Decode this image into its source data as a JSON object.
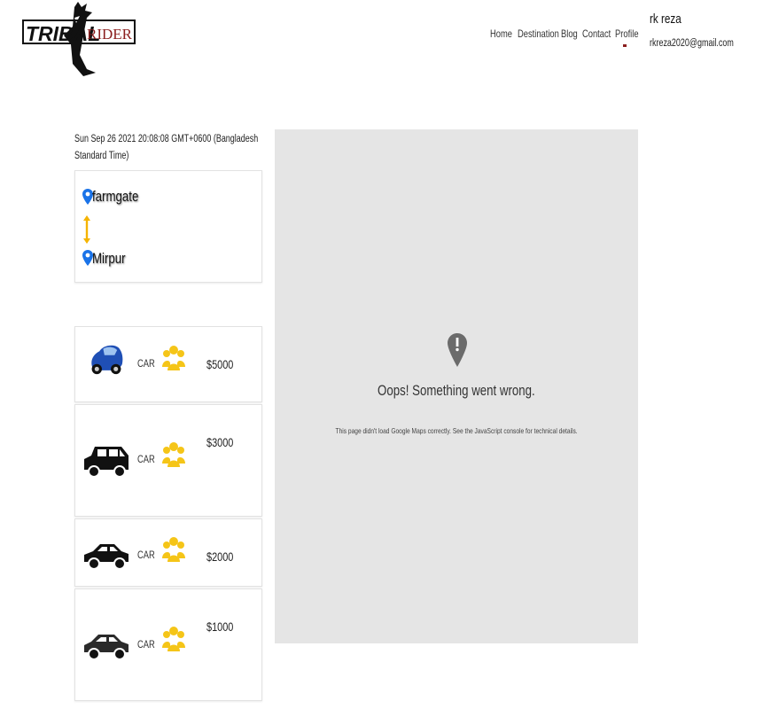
{
  "header": {
    "logo_text_left": "TRIBAL",
    "logo_text_right": "RIDER",
    "nav": [
      "Home",
      "Destination",
      "Blog",
      "Contact",
      "Profile"
    ],
    "user_name": "rk reza",
    "user_email": "rkreza2020@gmail.com"
  },
  "trip": {
    "datetime": "Sun Sep 26 2021 20:08:08 GMT+0600 (Bangladesh Standard Time)",
    "from": "farmgate",
    "to": "Mirpur"
  },
  "vehicles": [
    {
      "type": "CAR",
      "price": "$5000",
      "icon": "blue-car-icon"
    },
    {
      "type": "CAR",
      "price": "$3000",
      "icon": "suv-icon"
    },
    {
      "type": "CAR",
      "price": "$2000",
      "icon": "sedan-icon"
    },
    {
      "type": "CAR",
      "price": "$1000",
      "icon": "compact-car-icon"
    }
  ],
  "map": {
    "error_title": "Oops! Something went wrong.",
    "error_detail": "This page didn't load Google Maps correctly. See the JavaScript console for technical details."
  },
  "colors": {
    "accent_yellow": "#f5c518",
    "pin_blue": "#1a73e8",
    "nav_dot": "#8b1e1e",
    "map_bg": "#e5e5e5"
  }
}
